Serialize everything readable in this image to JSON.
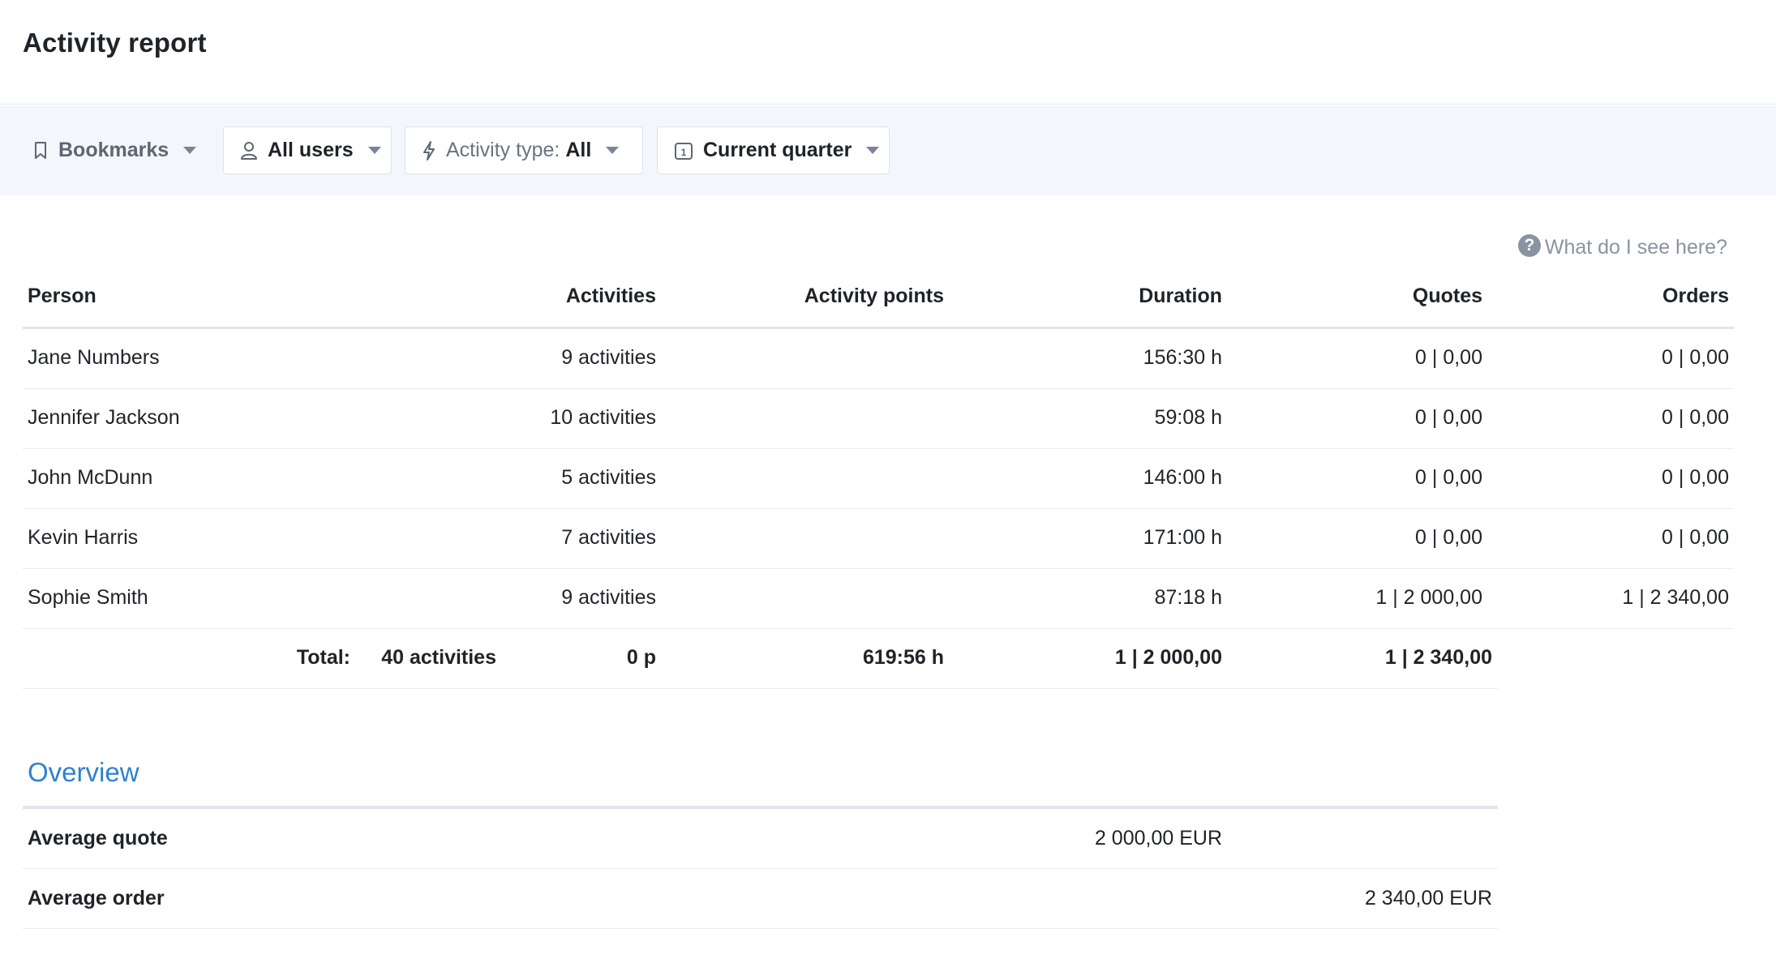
{
  "page": {
    "title": "Activity report"
  },
  "filters": {
    "bookmarks": "Bookmarks",
    "users": "All users",
    "activity_type_label": "Activity type:",
    "activity_type_value": "All",
    "period": "Current quarter",
    "calendar_day": "1"
  },
  "help": {
    "text": "What do I see here?"
  },
  "table": {
    "headers": {
      "person": "Person",
      "activities": "Activities",
      "points": "Activity points",
      "duration": "Duration",
      "quotes": "Quotes",
      "orders": "Orders"
    },
    "rows": [
      {
        "person": "Jane Numbers",
        "activities": "9 activities",
        "duration": "156:30 h",
        "quotes": "0 | 0,00",
        "orders": "0 | 0,00"
      },
      {
        "person": "Jennifer Jackson",
        "activities": "10 activities",
        "duration": "59:08 h",
        "quotes": "0 | 0,00",
        "orders": "0 | 0,00"
      },
      {
        "person": "John McDunn",
        "activities": "5 activities",
        "duration": "146:00 h",
        "quotes": "0 | 0,00",
        "orders": "0 | 0,00"
      },
      {
        "person": "Kevin Harris",
        "activities": "7 activities",
        "duration": "171:00 h",
        "quotes": "0 | 0,00",
        "orders": "0 | 0,00"
      },
      {
        "person": "Sophie Smith",
        "activities": "9 activities",
        "duration": "87:18 h",
        "quotes": "1 | 2 000,00",
        "orders": "1 | 2 340,00"
      }
    ],
    "total": {
      "label": "Total:",
      "activities": "40 activities",
      "points": "0 p",
      "duration": "619:56 h",
      "quotes": "1 | 2 000,00",
      "orders": "1 | 2 340,00"
    }
  },
  "overview": {
    "title": "Overview",
    "average_quote_label": "Average quote",
    "average_quote_value": "2 000,00 EUR",
    "average_order_label": "Average order",
    "average_order_value": "2 340,00 EUR"
  }
}
